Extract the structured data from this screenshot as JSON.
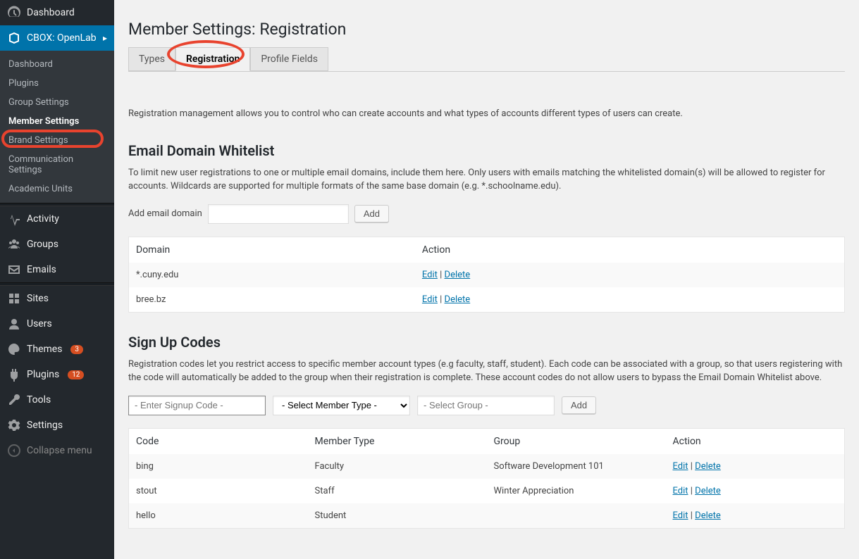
{
  "sidebar": {
    "items": [
      {
        "icon": "gauge-icon",
        "label": "Dashboard"
      },
      {
        "icon": "box-icon",
        "label": "CBOX: OpenLab",
        "current": true
      },
      {
        "sub": [
          {
            "label": "Dashboard"
          },
          {
            "label": "Plugins"
          },
          {
            "label": "Group Settings"
          },
          {
            "label": "Member Settings",
            "active": true
          },
          {
            "label": "Brand Settings"
          },
          {
            "label": "Communication Settings"
          },
          {
            "label": "Academic Units"
          }
        ]
      },
      {
        "separator": true
      },
      {
        "icon": "activity-icon",
        "label": "Activity"
      },
      {
        "icon": "groups-icon",
        "label": "Groups"
      },
      {
        "icon": "email-icon",
        "label": "Emails"
      },
      {
        "separator": true
      },
      {
        "icon": "sites-icon",
        "label": "Sites"
      },
      {
        "icon": "users-icon",
        "label": "Users"
      },
      {
        "icon": "themes-icon",
        "label": "Themes",
        "badge": "3"
      },
      {
        "icon": "plugins-icon",
        "label": "Plugins",
        "badge": "12"
      },
      {
        "icon": "tools-icon",
        "label": "Tools"
      },
      {
        "icon": "settings-icon",
        "label": "Settings"
      },
      {
        "icon": "collapse-icon",
        "label": "Collapse menu",
        "collapse": true
      }
    ]
  },
  "page": {
    "title": "Member Settings: Registration",
    "tabs": [
      {
        "label": "Types"
      },
      {
        "label": "Registration",
        "active": true
      },
      {
        "label": "Profile Fields"
      }
    ],
    "intro": "Registration management allows you to control who can create accounts and what types of accounts different types of users can create."
  },
  "whitelist": {
    "heading": "Email Domain Whitelist",
    "desc": "To limit new user registrations to one or multiple email domains, include them here. Only users with emails matching the whitelisted domain(s) will be allowed to register for accounts. Wildcards are supported for multiple formats of the same base domain (e.g. *.schoolname.edu).",
    "add_label": "Add email domain",
    "add_button": "Add",
    "columns": {
      "domain": "Domain",
      "action": "Action"
    },
    "actions": {
      "edit": "Edit",
      "delete": "Delete"
    },
    "rows": [
      {
        "domain": "*.cuny.edu"
      },
      {
        "domain": "bree.bz"
      }
    ]
  },
  "signup": {
    "heading": "Sign Up Codes",
    "desc": "Registration codes let you restrict access to specific member account types (e.g faculty, staff, student). Each code can be associated with a group, so that users registering with the code will automatically be added to the group when their registration is complete. These account codes do not allow users to bypass the Email Domain Whitelist above.",
    "code_placeholder": "- Enter Signup Code -",
    "member_type_placeholder": "- Select Member Type -",
    "group_placeholder": "- Select Group -",
    "add_button": "Add",
    "columns": {
      "code": "Code",
      "member_type": "Member Type",
      "group": "Group",
      "action": "Action"
    },
    "actions": {
      "edit": "Edit",
      "delete": "Delete"
    },
    "rows": [
      {
        "code": "bing",
        "member_type": "Faculty",
        "group": "Software Development 101"
      },
      {
        "code": "stout",
        "member_type": "Staff",
        "group": "Winter Appreciation"
      },
      {
        "code": "hello",
        "member_type": "Student",
        "group": ""
      }
    ]
  }
}
